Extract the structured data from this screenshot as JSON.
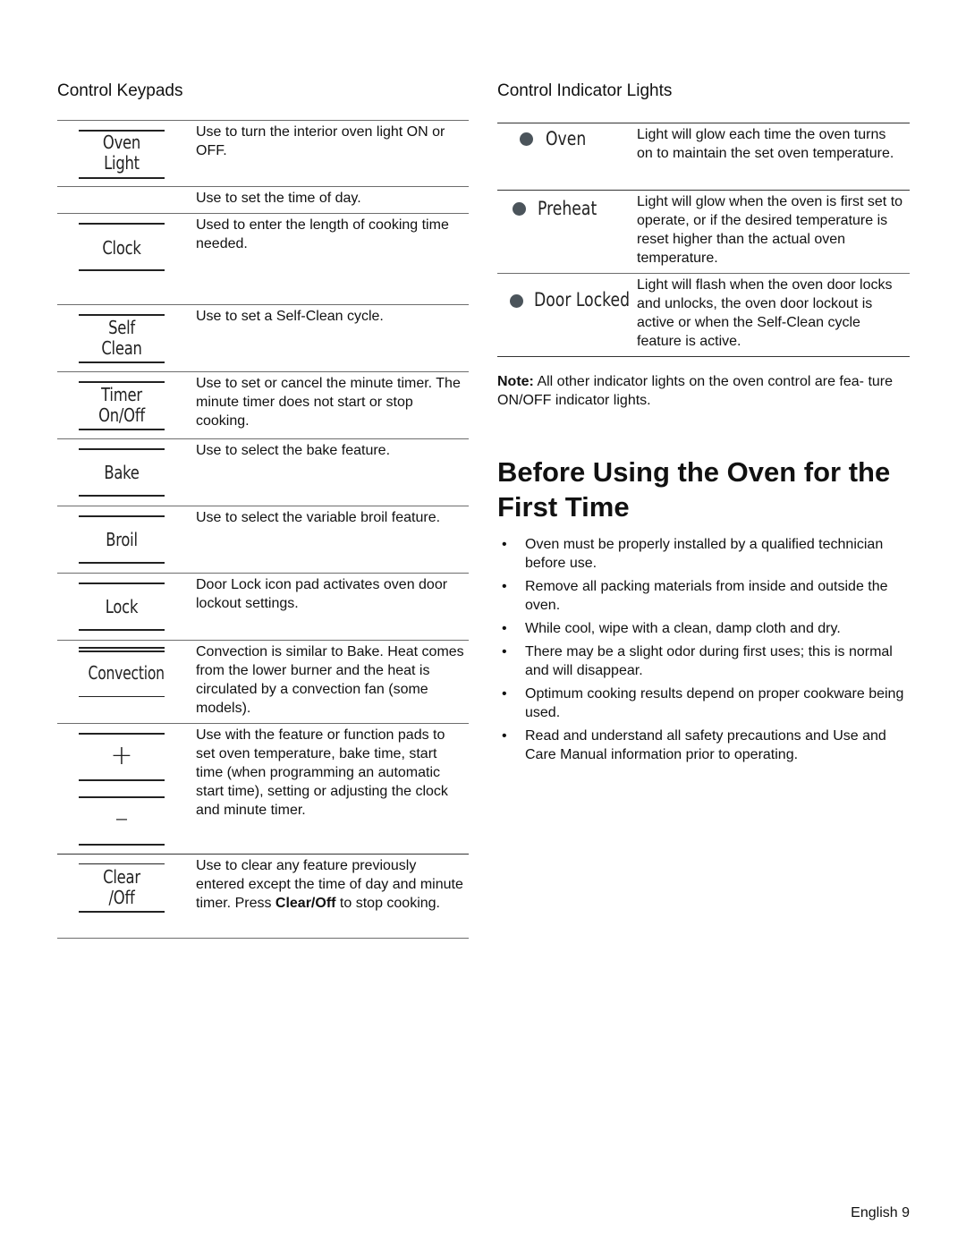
{
  "keypads": {
    "title": "Control Keypads",
    "rows": [
      {
        "label_lines": [
          "Oven",
          "Light"
        ],
        "description": "Use to turn the interior oven light ON or OFF."
      },
      {
        "label_lines": [],
        "description": "Use to set the time of day."
      },
      {
        "label_lines": [
          "Clock"
        ],
        "description": "Used to enter the length of cooking time needed."
      },
      {
        "label_lines": [
          "Self",
          "Clean"
        ],
        "description": "Use to set a Self-Clean cycle."
      },
      {
        "label_lines": [
          "Timer",
          "On/Off"
        ],
        "description": "Use to set or cancel the minute timer. The minute timer does not start or stop cooking."
      },
      {
        "label_lines": [
          "Bake"
        ],
        "description": "Use to select the bake feature."
      },
      {
        "label_lines": [
          "Broil"
        ],
        "description": "Use to select the variable broil feature."
      },
      {
        "label_lines": [
          "Lock"
        ],
        "description": "Door Lock icon pad activates oven door lockout settings."
      },
      {
        "label_lines": [
          "Convection"
        ],
        "description": "Convection is similar to Bake. Heat comes from the lower burner and the heat is circulated by a convection fan (some models)."
      },
      {
        "symbols": [
          "+",
          "–"
        ],
        "description": "Use with the feature or function pads to set oven temperature, bake time, start time (when programming an automatic start time), setting or adjusting the clock and minute timer."
      },
      {
        "label_lines": [
          "Clear",
          "/Off"
        ],
        "description_before": "Use to clear any feature previously entered except the time of day and minute timer. Press ",
        "description_bold": "Clear/Off",
        "description_after": " to stop cooking."
      }
    ]
  },
  "indicator_lights": {
    "title": "Control Indicator Lights",
    "dot_color": "#4b545b",
    "rows": [
      {
        "name": "Oven",
        "description": "Light will glow each time the oven turns on to maintain the set oven temperature."
      },
      {
        "name": "Preheat",
        "description": "Light will glow when the oven is first set to operate, or if the desired temperature is reset higher than the actual oven temperature."
      },
      {
        "name": "Door Locked",
        "description": "Light will flash when the oven door locks and unlocks, the oven door lockout is active or when the Self-Clean cycle feature is active."
      }
    ],
    "note_label": "Note:",
    "note_text": " All other indicator lights on the oven control are fea- ture ON/OFF indicator lights."
  },
  "before_first_use": {
    "heading": "Before Using the Oven for the First Time",
    "bullet_char": "•",
    "bullets": [
      "Oven must be properly installed by a qualified technician before use.",
      "Remove all packing materials from inside and outside the oven.",
      "While cool, wipe with a clean, damp cloth and dry.",
      "There may be a slight odor during first uses; this is normal and will disappear.",
      "Optimum cooking results depend on proper cookware being used.",
      "Read and understand all safety precautions and Use and Care Manual information prior to operating."
    ]
  },
  "footer": {
    "page_label": "English 9"
  }
}
